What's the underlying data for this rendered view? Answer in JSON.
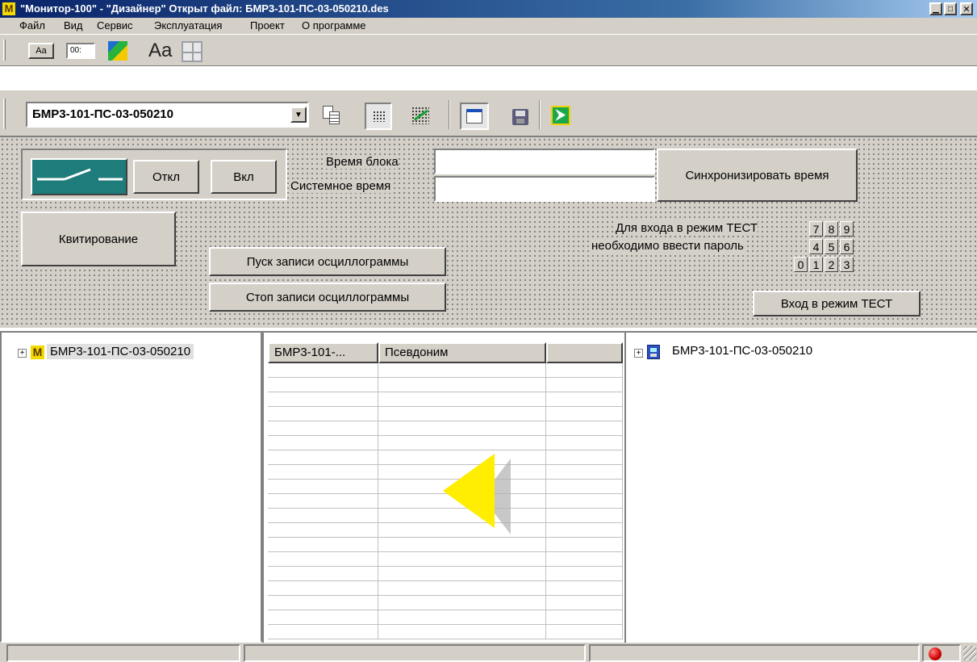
{
  "window": {
    "title": "\"Монитор-100\" - \"Дизайнер\" Открыт файл: БМР3-101-ПС-03-050210.des",
    "app_icon_letter": "M"
  },
  "menu": [
    "Файл",
    "Вид",
    "Сервис",
    "Эксплуатация",
    "Проект",
    "О программе"
  ],
  "toolbar1": {
    "label_button": "Aa",
    "time_button": "00:",
    "text_style": "Aa"
  },
  "toolbar2": {
    "device_select_value": "БМР3-101-ПС-03-050210"
  },
  "panel": {
    "off_button": "Откл",
    "on_button": "Вкл",
    "block_time_label": "Время блока",
    "system_time_label": "Системное время",
    "block_time_value": "",
    "system_time_value": "",
    "sync_button": "Синхронизировать время",
    "ack_button": "Квитирование",
    "start_osc_button": "Пуск записи осциллограммы",
    "stop_osc_button": "Стоп записи осциллограммы",
    "test_hint_line1": "Для входа в режим ТЕСТ",
    "test_hint_line2": "необходимо ввести пароль",
    "keypad": [
      "7",
      "8",
      "9",
      "4",
      "5",
      "6",
      "0",
      "1",
      "2",
      "3"
    ],
    "enter_test_button": "Вход в режим ТЕСТ"
  },
  "left_tree": {
    "root_label": "БМР3-101-ПС-03-050210"
  },
  "grid": {
    "columns": [
      "БМР3-101-...",
      "Псевдоним",
      ""
    ]
  },
  "right_tree": {
    "root_label": "БМР3-101-ПС-03-050210"
  },
  "colors": {
    "titlebar": "#0a246a",
    "breaker": "#1e7d7a",
    "arrow": "#ffee00",
    "led": "#d00000"
  }
}
